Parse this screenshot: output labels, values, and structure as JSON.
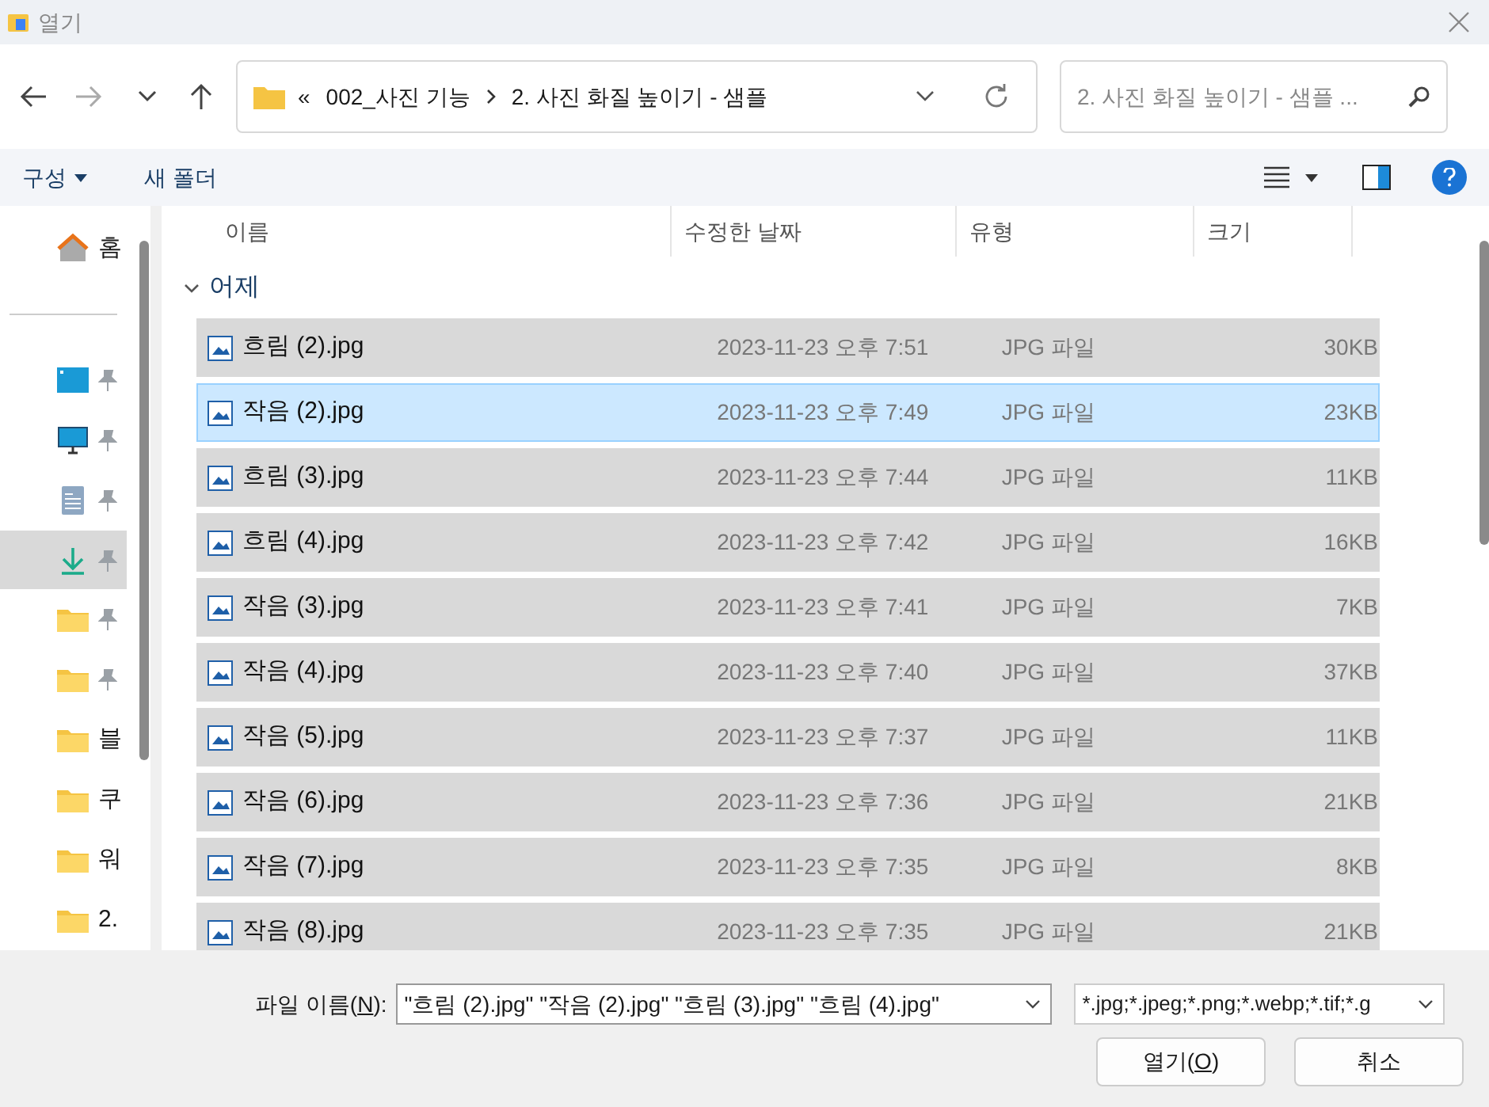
{
  "window": {
    "title": "열기"
  },
  "address": {
    "overflow": "«",
    "segments": [
      "002_사진 기능",
      "2. 사진 화질 높이기 - 샘플"
    ]
  },
  "search": {
    "placeholder": "2. 사진 화질 높이기 - 샘플 ..."
  },
  "toolbar": {
    "organize": "구성",
    "new_folder": "새 폴더"
  },
  "sidebar": {
    "items": [
      {
        "kind": "home",
        "label": "홈",
        "pinned": false,
        "selected": false
      },
      {
        "kind": "divider"
      },
      {
        "kind": "desktop",
        "pinned": true,
        "selected": false
      },
      {
        "kind": "monitor",
        "pinned": true,
        "selected": false
      },
      {
        "kind": "document",
        "pinned": true,
        "selected": false
      },
      {
        "kind": "download",
        "pinned": true,
        "selected": true
      },
      {
        "kind": "folder",
        "pinned": true,
        "selected": false
      },
      {
        "kind": "folder",
        "pinned": true,
        "selected": false
      },
      {
        "kind": "folder",
        "label": "블",
        "pinned": false,
        "selected": false
      },
      {
        "kind": "folder",
        "label": "쿠",
        "pinned": false,
        "selected": false
      },
      {
        "kind": "folder",
        "label": "워",
        "pinned": false,
        "selected": false
      },
      {
        "kind": "folder",
        "label": "2.",
        "pinned": false,
        "selected": false
      }
    ]
  },
  "table": {
    "columns": [
      "이름",
      "수정한 날짜",
      "유형",
      "크기"
    ],
    "group": {
      "label": "어제",
      "expanded": true
    },
    "rows": [
      {
        "name": "흐림 (2).jpg",
        "date": "2023-11-23 오후 7:51",
        "type": "JPG 파일",
        "size": "30KB",
        "selected": true,
        "focused": false
      },
      {
        "name": "작음 (2).jpg",
        "date": "2023-11-23 오후 7:49",
        "type": "JPG 파일",
        "size": "23KB",
        "selected": true,
        "focused": true
      },
      {
        "name": "흐림 (3).jpg",
        "date": "2023-11-23 오후 7:44",
        "type": "JPG 파일",
        "size": "11KB",
        "selected": true,
        "focused": false
      },
      {
        "name": "흐림 (4).jpg",
        "date": "2023-11-23 오후 7:42",
        "type": "JPG 파일",
        "size": "16KB",
        "selected": true,
        "focused": false
      },
      {
        "name": "작음 (3).jpg",
        "date": "2023-11-23 오후 7:41",
        "type": "JPG 파일",
        "size": "7KB",
        "selected": true,
        "focused": false
      },
      {
        "name": "작음 (4).jpg",
        "date": "2023-11-23 오후 7:40",
        "type": "JPG 파일",
        "size": "37KB",
        "selected": true,
        "focused": false
      },
      {
        "name": "작음 (5).jpg",
        "date": "2023-11-23 오후 7:37",
        "type": "JPG 파일",
        "size": "11KB",
        "selected": true,
        "focused": false
      },
      {
        "name": "작음 (6).jpg",
        "date": "2023-11-23 오후 7:36",
        "type": "JPG 파일",
        "size": "21KB",
        "selected": true,
        "focused": false
      },
      {
        "name": "작음 (7).jpg",
        "date": "2023-11-23 오후 7:35",
        "type": "JPG 파일",
        "size": "8KB",
        "selected": true,
        "focused": false
      },
      {
        "name": "작음 (8).jpg",
        "date": "2023-11-23 오후 7:35",
        "type": "JPG 파일",
        "size": "21KB",
        "selected": true,
        "focused": false
      }
    ]
  },
  "footer": {
    "filename_label": "파일 이름(**N**):",
    "filename_value": "\"흐림 (2).jpg\" \"작음 (2).jpg\" \"흐림 (3).jpg\" \"흐림 (4).jpg\"",
    "filter": "*.jpg;*.jpeg;*.png;*.webp;*.tif;*.g",
    "open": "열기(**O**)",
    "cancel": "취소"
  }
}
